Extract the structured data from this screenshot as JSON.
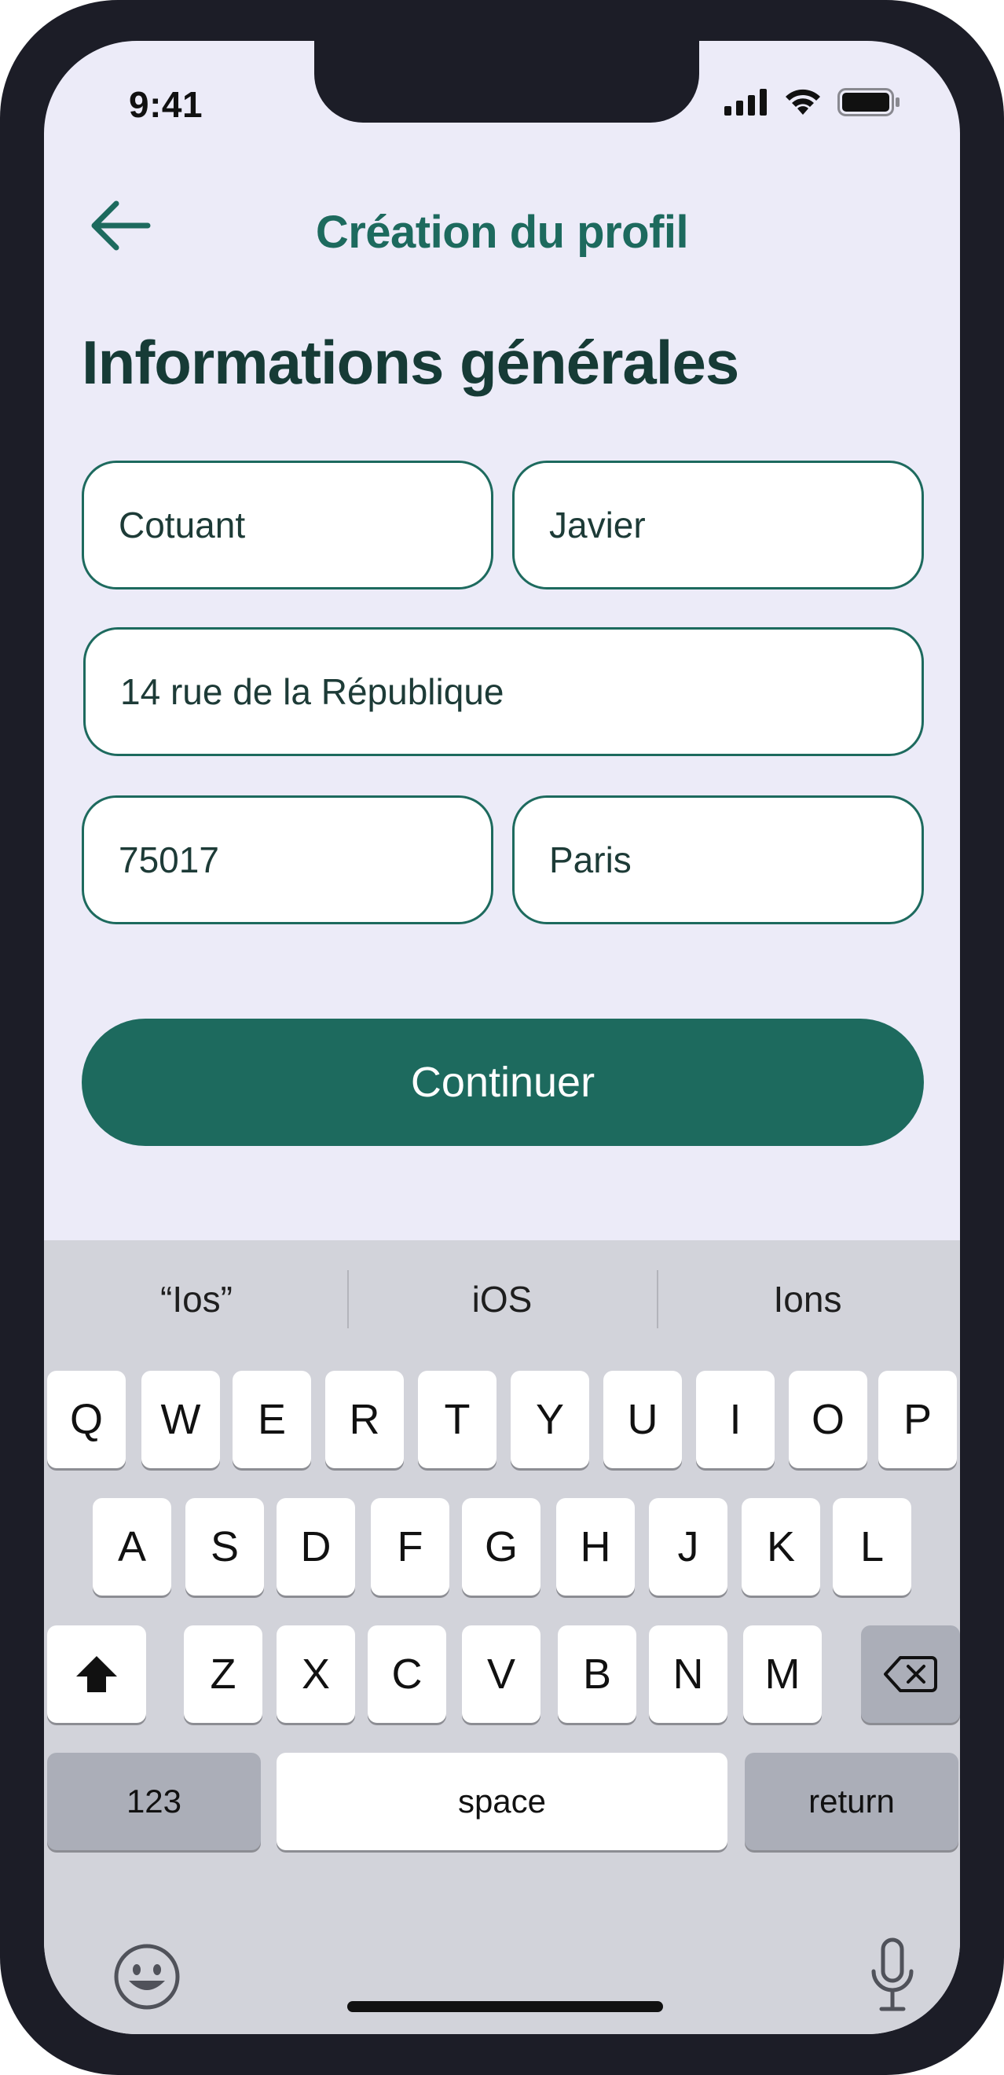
{
  "status_bar": {
    "time": "9:41",
    "icons": [
      "signal-icon",
      "wifi-icon",
      "battery-icon"
    ]
  },
  "header": {
    "back_icon": "arrow-left-icon",
    "title": "Création du profil"
  },
  "form": {
    "section_title": "Informations générales",
    "last_name": "Cotuant",
    "first_name": "Javier",
    "address": "14 rue de la République",
    "postal_code": "75017",
    "city": "Paris"
  },
  "cta": {
    "label": "Continuer"
  },
  "keyboard": {
    "suggestions": [
      "“Ios”",
      "iOS",
      "Ions"
    ],
    "row1": [
      "Q",
      "W",
      "E",
      "R",
      "T",
      "Y",
      "U",
      "I",
      "O",
      "P"
    ],
    "row2": [
      "A",
      "S",
      "D",
      "F",
      "G",
      "H",
      "J",
      "K",
      "L"
    ],
    "row3": [
      "Z",
      "X",
      "C",
      "V",
      "B",
      "N",
      "M"
    ],
    "numbers_label": "123",
    "space_label": "space",
    "return_label": "return",
    "shift_icon": "shift-icon",
    "delete_icon": "delete-icon",
    "emoji_icon": "emoji-icon",
    "mic_icon": "microphone-icon"
  },
  "colors": {
    "accent": "#1d6a5e",
    "background": "#ecebf8",
    "keyboard_bg": "#d2d3da"
  }
}
